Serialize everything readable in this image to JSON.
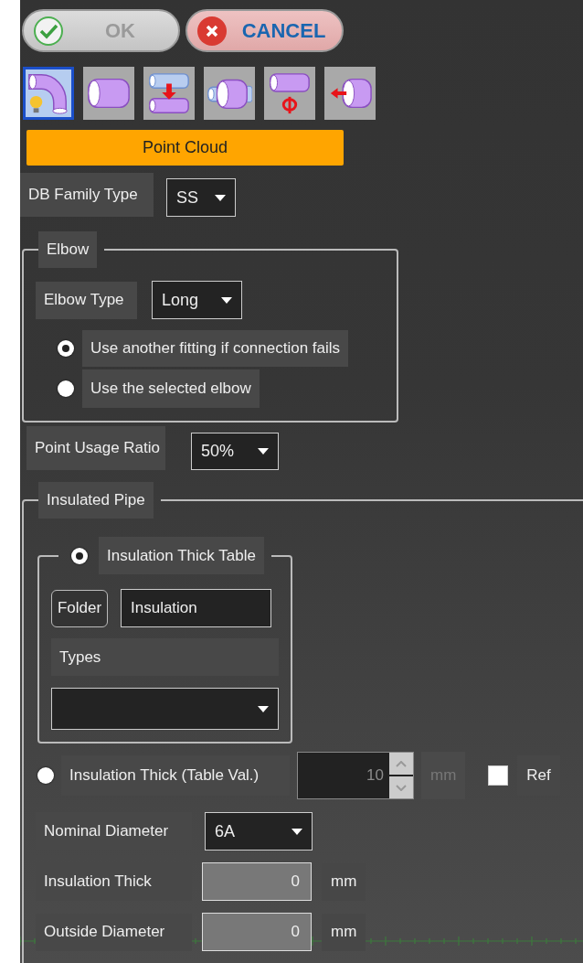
{
  "buttons": [
    {
      "label": "OK",
      "kind": "ok",
      "disabled": true
    },
    {
      "label": "CANCEL",
      "kind": "cancel",
      "disabled": false
    }
  ],
  "tools": [
    {
      "kind": "elbow",
      "selected": true
    },
    {
      "kind": "pipe",
      "selected": false
    },
    {
      "kind": "move",
      "selected": false
    },
    {
      "kind": "reducer",
      "selected": false
    },
    {
      "kind": "diameter",
      "selected": false
    },
    {
      "kind": "insert",
      "selected": false
    }
  ],
  "point_cloud": {
    "label": "Point Cloud"
  },
  "db_family_type": {
    "label": "DB Family Type",
    "value": "SS"
  },
  "elbow": {
    "title": "Elbow",
    "type_label": "Elbow Type",
    "type_value": "Long",
    "options": [
      {
        "label": "Use another fitting if connection fails",
        "selected": true
      },
      {
        "label": "Use the selected elbow",
        "selected": false
      }
    ]
  },
  "point_usage_ratio": {
    "label": "Point Usage Ratio",
    "value": "50%"
  },
  "insulated_pipe": {
    "title": "Insulated Pipe",
    "table": {
      "label": "Insulation Thick Table",
      "selected": true,
      "folder_button": "Folder",
      "folder_value": "Insulation",
      "types_label": "Types"
    },
    "table_value": {
      "label": "Insulation Thick (Table Val.)",
      "selected": false,
      "value": "10",
      "unit": "mm",
      "disabled": true,
      "ref_label": "Ref",
      "ref_checked": false
    },
    "fields": [
      {
        "kind": "select",
        "label": "Nominal Diameter",
        "value": "6A"
      },
      {
        "kind": "number",
        "label": "Insulation Thick",
        "value": "0",
        "unit": "mm"
      },
      {
        "kind": "number",
        "label": "Outside Diameter",
        "value": "0",
        "unit": "mm"
      }
    ]
  }
}
